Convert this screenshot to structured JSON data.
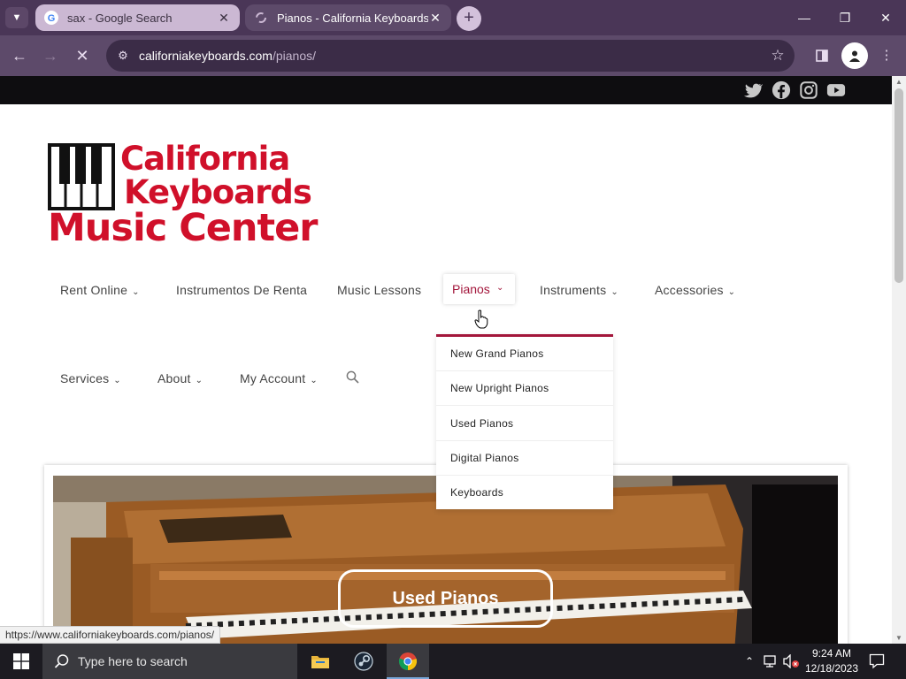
{
  "browser": {
    "tabs": [
      {
        "title": "sax - Google Search",
        "active": false
      },
      {
        "title": "Pianos - California Keyboards M",
        "active": true
      }
    ],
    "url_host": "californiakeyboards.com",
    "url_path": "/pianos/",
    "status_url": "https://www.californiakeyboards.com/pianos/"
  },
  "site": {
    "logo": {
      "line1": "California",
      "line2": "Keyboards",
      "line3": "Music Center"
    },
    "social": [
      "twitter-icon",
      "facebook-icon",
      "instagram-icon",
      "youtube-icon"
    ],
    "nav_row1": [
      {
        "label": "Rent Online",
        "has_dropdown": true
      },
      {
        "label": "Instrumentos De Renta",
        "has_dropdown": false
      },
      {
        "label": "Music Lessons",
        "has_dropdown": false
      },
      {
        "label": "Pianos",
        "has_dropdown": true
      },
      {
        "label": "Instruments",
        "has_dropdown": true
      },
      {
        "label": "Accessories",
        "has_dropdown": true
      }
    ],
    "nav_row2": [
      {
        "label": "Services",
        "has_dropdown": true
      },
      {
        "label": "About",
        "has_dropdown": true
      },
      {
        "label": "My Account",
        "has_dropdown": true
      }
    ],
    "pianos_dropdown": [
      "New Grand Pianos",
      "New Upright Pianos",
      "Used Pianos",
      "Digital Pianos",
      "Keyboards"
    ],
    "hero_button": "Used Pianos",
    "accent_color": "#a3163b",
    "logo_color": "#d0102a"
  },
  "taskbar": {
    "search_placeholder": "Type here to search",
    "time": "9:24 AM",
    "date": "12/18/2023"
  }
}
